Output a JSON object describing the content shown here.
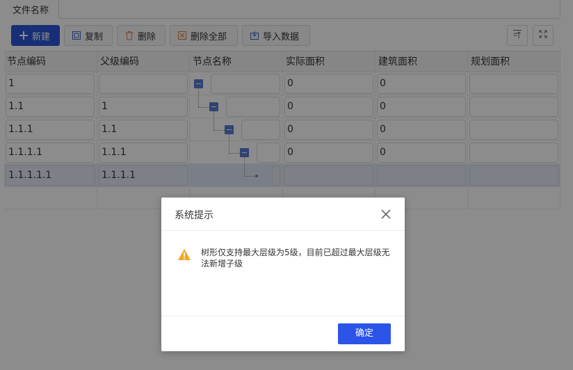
{
  "form": {
    "field_label": "文件名称",
    "field_value": ""
  },
  "toolbar": {
    "new_label": "新建",
    "copy_label": "复制",
    "delete_label": "删除",
    "delete_all_label": "删除全部",
    "import_label": "导入数据"
  },
  "table": {
    "columns": [
      "节点编码",
      "父级编码",
      "节点名称",
      "实际面积",
      "建筑面积",
      "规划面积"
    ],
    "rows": [
      {
        "code": "1",
        "parent": "",
        "name": "",
        "actual": "0",
        "building": "0",
        "planned": ""
      },
      {
        "code": "1.1",
        "parent": "1",
        "name": "",
        "actual": "0",
        "building": "0",
        "planned": ""
      },
      {
        "code": "1.1.1",
        "parent": "1.1",
        "name": "",
        "actual": "0",
        "building": "0",
        "planned": ""
      },
      {
        "code": "1.1.1.1",
        "parent": "1.1.1",
        "name": "",
        "actual": "0",
        "building": "0",
        "planned": ""
      },
      {
        "code": "1.1.1.1.1",
        "parent": "1.1.1.1",
        "name": "",
        "actual": "",
        "building": "",
        "planned": ""
      }
    ]
  },
  "dialog": {
    "title": "系统提示",
    "message": "树形仅支持最大层级为5级，目前已超过最大层级无法新增子级",
    "ok_label": "确定"
  },
  "colors": {
    "primary": "#2c54d8",
    "warning": "#f5a623",
    "tree_toggle": "#5a7bd1"
  },
  "icons": [
    "plus-icon",
    "copy-icon",
    "trash-icon",
    "delete-all-icon",
    "import-icon",
    "collapse-top-icon",
    "fullscreen-icon",
    "tree-collapse-icon",
    "warning-icon",
    "close-icon"
  ]
}
